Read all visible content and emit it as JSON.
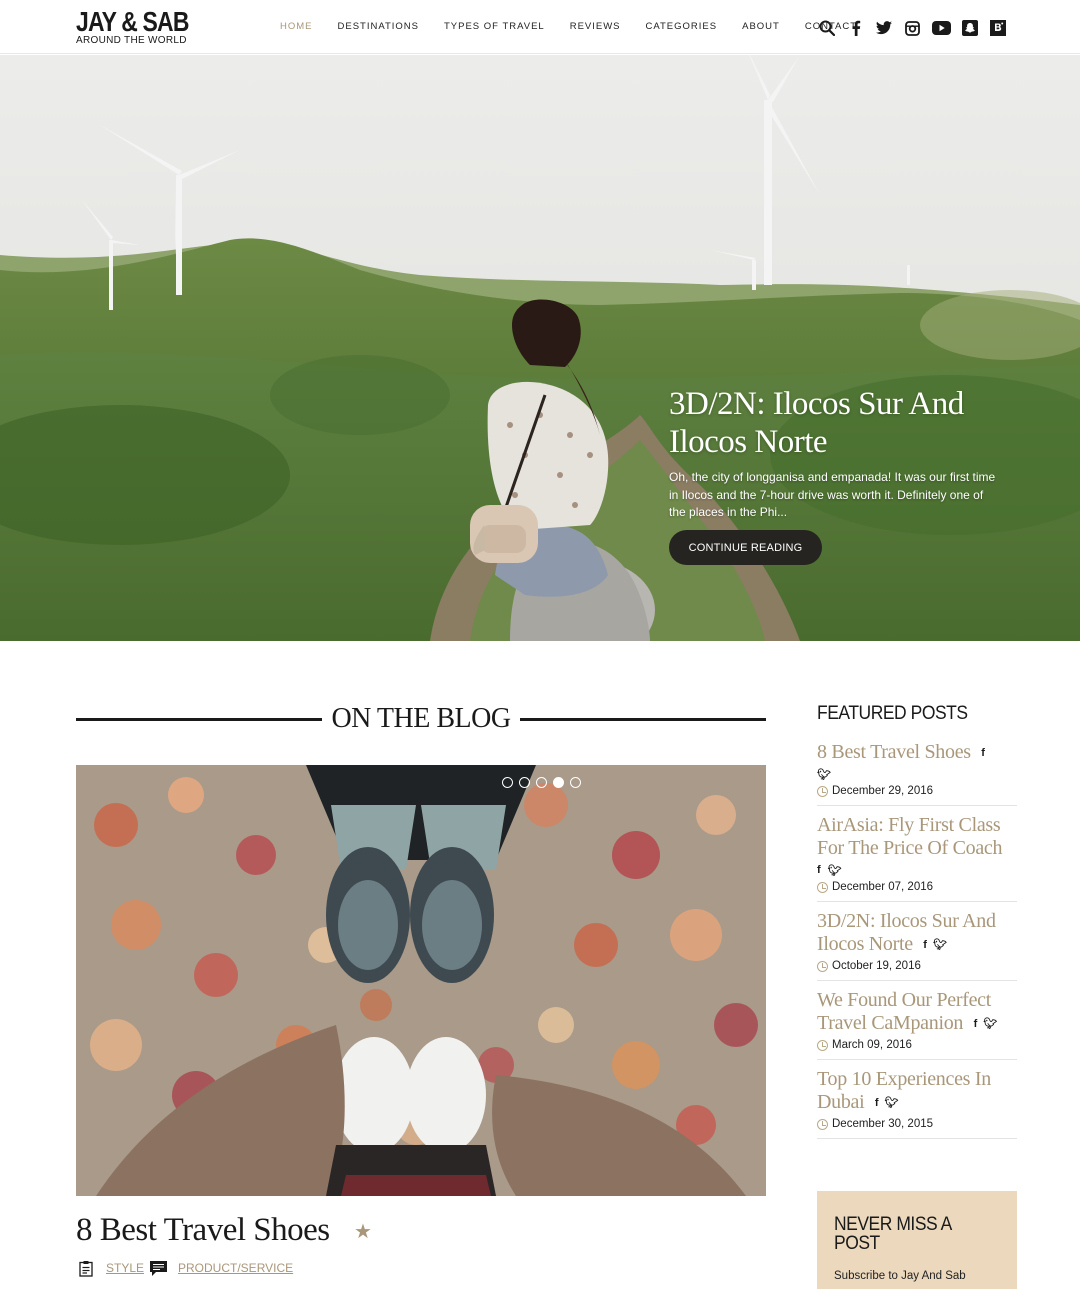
{
  "header": {
    "logo_main": "JAY & SAB",
    "logo_sub": "AROUND THE WORLD",
    "nav": [
      {
        "label": "HOME",
        "active": true
      },
      {
        "label": "DESTINATIONS",
        "active": false
      },
      {
        "label": "TYPES OF TRAVEL",
        "active": false
      },
      {
        "label": "REVIEWS",
        "active": false
      },
      {
        "label": "CATEGORIES",
        "active": false
      },
      {
        "label": "ABOUT",
        "active": false
      },
      {
        "label": "CONTACT",
        "active": false
      }
    ],
    "icons": [
      "search-icon",
      "facebook-icon",
      "twitter-icon",
      "instagram-icon",
      "youtube-icon",
      "snapchat-icon",
      "bloglovin-icon"
    ]
  },
  "hero": {
    "title": "3D/2N: Ilocos Sur And Ilocos Norte",
    "excerpt": "Oh, the city of longganisa and empanada! It was our first time in Ilocos and the 7-hour drive was worth it. Definitely one of the places in the Phi...",
    "button_label": "CONTINUE READING"
  },
  "blog": {
    "section_title": "ON THE BLOG",
    "slider_dots": 5,
    "active_dot": 4,
    "post_title": "8 Best Travel Shoes",
    "categories": [
      "STYLE",
      "PRODUCT/SERVICE"
    ]
  },
  "sidebar": {
    "featured_heading": "FEATURED POSTS",
    "posts": [
      {
        "title": "8 Best Travel Shoes",
        "date": "December 29, 2016"
      },
      {
        "title": "AirAsia: Fly First Class For The Price Of Coach",
        "date": "December 07, 2016"
      },
      {
        "title": "3D/2N: Ilocos Sur And Ilocos Norte",
        "date": "October 19, 2016"
      },
      {
        "title": "We Found Our Perfect Travel CaMpanion",
        "date": "March 09, 2016"
      },
      {
        "title": "Top 10 Experiences In Dubai",
        "date": "December 30, 2015"
      }
    ],
    "social_labels": {
      "facebook": "f",
      "twitter": "❦"
    },
    "newsletter_title": "NEVER MISS A POST",
    "newsletter_sub": "Subscribe to Jay And Sab"
  },
  "colors": {
    "accent": "#a9977a",
    "dark": "#1a1a1a",
    "newsletter_bg": "#ecd8bd",
    "button_bg": "#262421"
  }
}
